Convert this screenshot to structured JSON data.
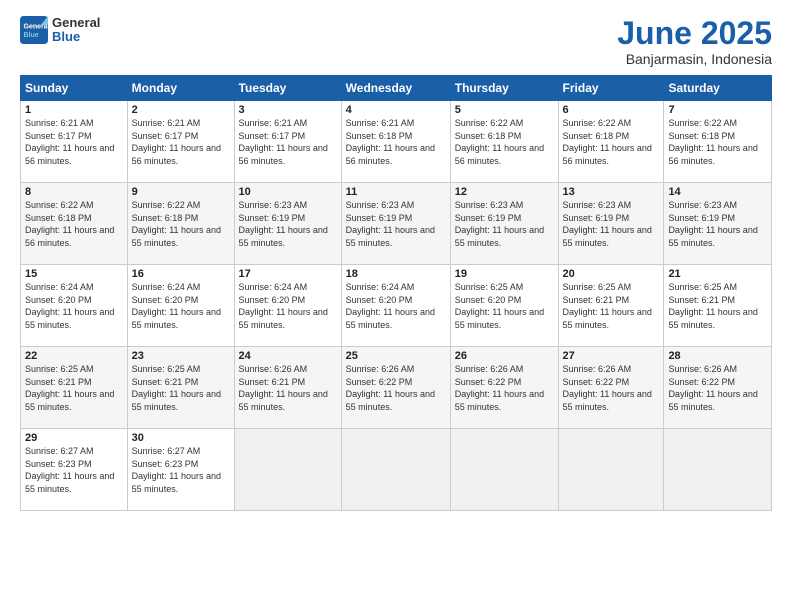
{
  "logo": {
    "general": "General",
    "blue": "Blue"
  },
  "title": "June 2025",
  "location": "Banjarmasin, Indonesia",
  "days_header": [
    "Sunday",
    "Monday",
    "Tuesday",
    "Wednesday",
    "Thursday",
    "Friday",
    "Saturday"
  ],
  "weeks": [
    [
      {
        "day": "1",
        "sunrise": "6:21 AM",
        "sunset": "6:17 PM",
        "daylight": "11 hours and 56 minutes."
      },
      {
        "day": "2",
        "sunrise": "6:21 AM",
        "sunset": "6:17 PM",
        "daylight": "11 hours and 56 minutes."
      },
      {
        "day": "3",
        "sunrise": "6:21 AM",
        "sunset": "6:17 PM",
        "daylight": "11 hours and 56 minutes."
      },
      {
        "day": "4",
        "sunrise": "6:21 AM",
        "sunset": "6:18 PM",
        "daylight": "11 hours and 56 minutes."
      },
      {
        "day": "5",
        "sunrise": "6:22 AM",
        "sunset": "6:18 PM",
        "daylight": "11 hours and 56 minutes."
      },
      {
        "day": "6",
        "sunrise": "6:22 AM",
        "sunset": "6:18 PM",
        "daylight": "11 hours and 56 minutes."
      },
      {
        "day": "7",
        "sunrise": "6:22 AM",
        "sunset": "6:18 PM",
        "daylight": "11 hours and 56 minutes."
      }
    ],
    [
      {
        "day": "8",
        "sunrise": "6:22 AM",
        "sunset": "6:18 PM",
        "daylight": "11 hours and 56 minutes."
      },
      {
        "day": "9",
        "sunrise": "6:22 AM",
        "sunset": "6:18 PM",
        "daylight": "11 hours and 55 minutes."
      },
      {
        "day": "10",
        "sunrise": "6:23 AM",
        "sunset": "6:19 PM",
        "daylight": "11 hours and 55 minutes."
      },
      {
        "day": "11",
        "sunrise": "6:23 AM",
        "sunset": "6:19 PM",
        "daylight": "11 hours and 55 minutes."
      },
      {
        "day": "12",
        "sunrise": "6:23 AM",
        "sunset": "6:19 PM",
        "daylight": "11 hours and 55 minutes."
      },
      {
        "day": "13",
        "sunrise": "6:23 AM",
        "sunset": "6:19 PM",
        "daylight": "11 hours and 55 minutes."
      },
      {
        "day": "14",
        "sunrise": "6:23 AM",
        "sunset": "6:19 PM",
        "daylight": "11 hours and 55 minutes."
      }
    ],
    [
      {
        "day": "15",
        "sunrise": "6:24 AM",
        "sunset": "6:20 PM",
        "daylight": "11 hours and 55 minutes."
      },
      {
        "day": "16",
        "sunrise": "6:24 AM",
        "sunset": "6:20 PM",
        "daylight": "11 hours and 55 minutes."
      },
      {
        "day": "17",
        "sunrise": "6:24 AM",
        "sunset": "6:20 PM",
        "daylight": "11 hours and 55 minutes."
      },
      {
        "day": "18",
        "sunrise": "6:24 AM",
        "sunset": "6:20 PM",
        "daylight": "11 hours and 55 minutes."
      },
      {
        "day": "19",
        "sunrise": "6:25 AM",
        "sunset": "6:20 PM",
        "daylight": "11 hours and 55 minutes."
      },
      {
        "day": "20",
        "sunrise": "6:25 AM",
        "sunset": "6:21 PM",
        "daylight": "11 hours and 55 minutes."
      },
      {
        "day": "21",
        "sunrise": "6:25 AM",
        "sunset": "6:21 PM",
        "daylight": "11 hours and 55 minutes."
      }
    ],
    [
      {
        "day": "22",
        "sunrise": "6:25 AM",
        "sunset": "6:21 PM",
        "daylight": "11 hours and 55 minutes."
      },
      {
        "day": "23",
        "sunrise": "6:25 AM",
        "sunset": "6:21 PM",
        "daylight": "11 hours and 55 minutes."
      },
      {
        "day": "24",
        "sunrise": "6:26 AM",
        "sunset": "6:21 PM",
        "daylight": "11 hours and 55 minutes."
      },
      {
        "day": "25",
        "sunrise": "6:26 AM",
        "sunset": "6:22 PM",
        "daylight": "11 hours and 55 minutes."
      },
      {
        "day": "26",
        "sunrise": "6:26 AM",
        "sunset": "6:22 PM",
        "daylight": "11 hours and 55 minutes."
      },
      {
        "day": "27",
        "sunrise": "6:26 AM",
        "sunset": "6:22 PM",
        "daylight": "11 hours and 55 minutes."
      },
      {
        "day": "28",
        "sunrise": "6:26 AM",
        "sunset": "6:22 PM",
        "daylight": "11 hours and 55 minutes."
      }
    ],
    [
      {
        "day": "29",
        "sunrise": "6:27 AM",
        "sunset": "6:23 PM",
        "daylight": "11 hours and 55 minutes."
      },
      {
        "day": "30",
        "sunrise": "6:27 AM",
        "sunset": "6:23 PM",
        "daylight": "11 hours and 55 minutes."
      },
      null,
      null,
      null,
      null,
      null
    ]
  ],
  "labels": {
    "sunrise": "Sunrise:",
    "sunset": "Sunset:",
    "daylight": "Daylight:"
  }
}
